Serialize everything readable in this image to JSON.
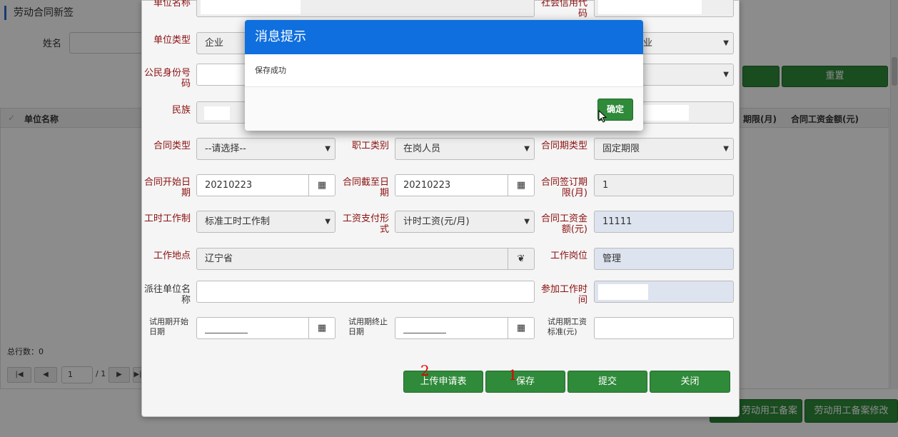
{
  "background": {
    "page_title": "劳动合同新签",
    "name_label": "姓名",
    "reset_button": "重置",
    "grid_columns": [
      "单位名称",
      "期限(月)",
      "合同工资金额(元)"
    ],
    "total_rows_label": "总行数：",
    "total_rows_value": "0",
    "pager": {
      "page_input": "1",
      "page_total": "/ 1"
    },
    "bottom_buttons": [
      "劳动用工备案",
      "劳动用工备案修改"
    ]
  },
  "form": {
    "unit_name_label": "单位名称",
    "credit_code_label": "社会信用代码",
    "unit_type_label": "单位类型",
    "unit_type_value": "企业",
    "industry_value": "业",
    "citizen_id_label": "公民身份号码",
    "ethnicity_label": "民族",
    "contract_type_label": "合同类型",
    "contract_type_value": "--请选择--",
    "employee_category_label": "职工类别",
    "employee_category_value": "在岗人员",
    "contract_term_type_label": "合同期类型",
    "contract_term_type_value": "固定期限",
    "start_date_label": "合同开始日期",
    "start_date_value": "20210223",
    "end_date_label": "合同截至日期",
    "end_date_value": "20210223",
    "signed_term_label": "合同签订期限(月)",
    "signed_term_value": "1",
    "work_hours_label": "工时工作制",
    "work_hours_value": "标准工时工作制",
    "wage_payment_label": "工资支付形式",
    "wage_payment_value": "计时工资(元/月)",
    "wage_amount_label": "合同工资金额(元)",
    "wage_amount_value": "11111",
    "work_location_label": "工作地点",
    "work_location_value": "辽宁省",
    "job_position_label": "工作岗位",
    "job_position_value": "管理",
    "dispatch_unit_label": "派往单位名称",
    "join_work_time_label": "参加工作时间",
    "probation_start_label": "试用期开始日期",
    "probation_end_label": "试用期终止日期",
    "probation_wage_label": "试用期工资标准(元)",
    "actions": {
      "upload": "上传申请表",
      "save": "保存",
      "submit": "提交",
      "close": "关闭"
    },
    "annotations": {
      "upload": "2",
      "save": "1"
    }
  },
  "dialog": {
    "title": "消息提示",
    "message": "保存成功",
    "ok_button": "确定"
  },
  "colors": {
    "primary_blue": "#0f6fde",
    "action_green": "#2f8a3a",
    "label_red": "#8b1010"
  }
}
